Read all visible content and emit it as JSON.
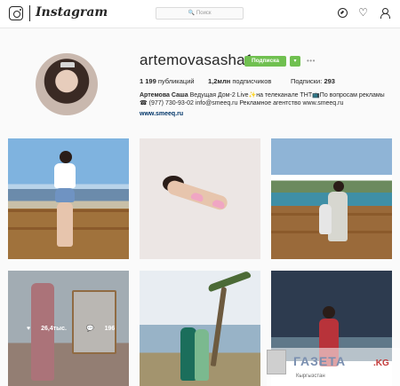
{
  "nav": {
    "logo": "Instagram",
    "search_placeholder": "Поиск",
    "search_glyph": "🔍",
    "heart_glyph": "♡"
  },
  "profile": {
    "username": "artemovasasha1",
    "subscribe_label": "Подписка",
    "dropdown_glyph": "▾",
    "more_glyph": "•••",
    "stats": {
      "posts_value": "1 199",
      "posts_label": "публикаций",
      "followers_value": "1,2млн",
      "followers_label": "подписчиков",
      "following_label": "Подписки:",
      "following_value": "293"
    },
    "bio_name": "Артемова Саша",
    "bio_text": "Ведущая Дом-2 Live✨на телеканале ТНТ📺По вопросам рекламы ☎ (977) 730-93-02 info@smeeq.ru Рекламное агентство www.smeeq.ru",
    "bio_link": "www.smeeq.ru"
  },
  "posts": {
    "hover_likes": "26,4тыс.",
    "hover_comments": "196",
    "like_glyph": "♥",
    "comment_glyph": "💬"
  },
  "watermark": {
    "text": "ГАЗЕТА",
    "suffix": ".KG",
    "subtitle": "Кыргызстан"
  },
  "colors": {
    "accent_green": "#70c050",
    "link_blue": "#003569"
  }
}
